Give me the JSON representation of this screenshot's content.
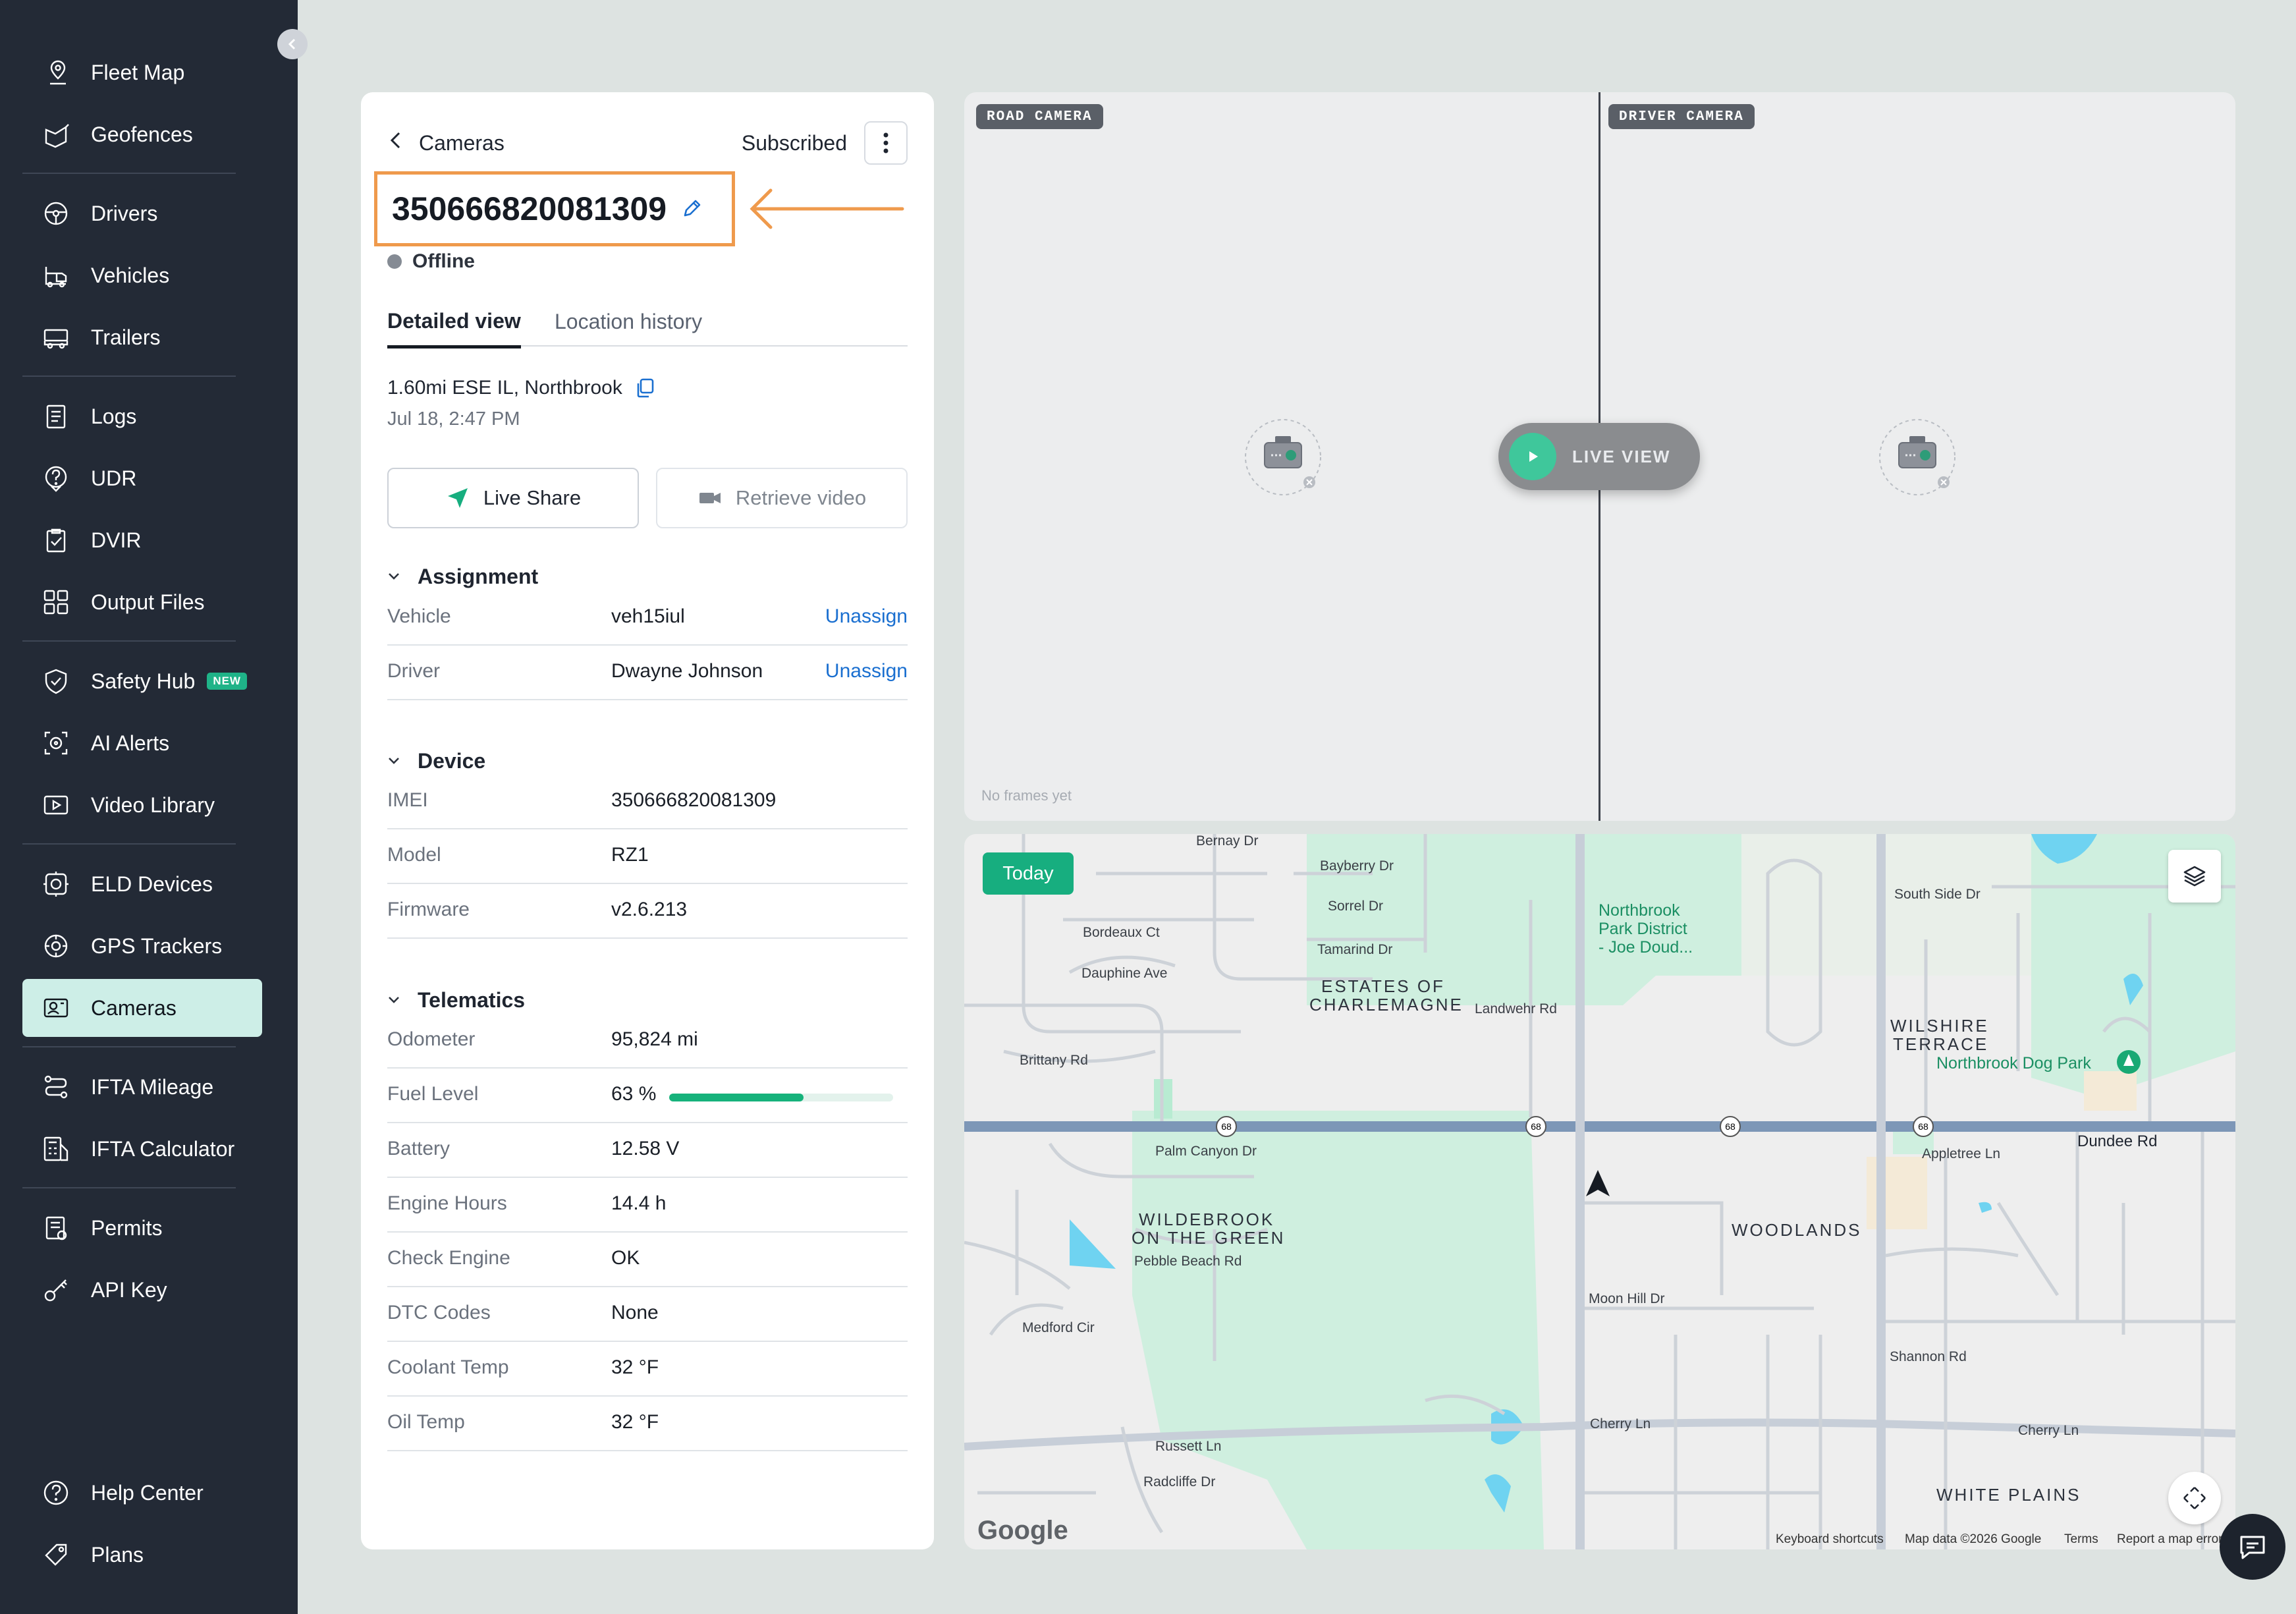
{
  "sidebar": {
    "items": [
      {
        "label": "Fleet Map",
        "icon": "fleet-map-icon"
      },
      {
        "label": "Geofences",
        "icon": "geofence-icon"
      },
      {
        "label": "Drivers",
        "icon": "steering-wheel-icon"
      },
      {
        "label": "Vehicles",
        "icon": "vehicle-icon"
      },
      {
        "label": "Trailers",
        "icon": "trailer-icon"
      },
      {
        "label": "Logs",
        "icon": "logs-icon"
      },
      {
        "label": "UDR",
        "icon": "question-icon"
      },
      {
        "label": "DVIR",
        "icon": "checklist-icon"
      },
      {
        "label": "Output Files",
        "icon": "files-icon"
      },
      {
        "label": "Safety Hub",
        "icon": "shield-icon",
        "badge": "NEW"
      },
      {
        "label": "AI Alerts",
        "icon": "ai-alert-icon"
      },
      {
        "label": "Video Library",
        "icon": "video-icon"
      },
      {
        "label": "ELD Devices",
        "icon": "eld-device-icon"
      },
      {
        "label": "GPS Trackers",
        "icon": "gps-tracker-icon"
      },
      {
        "label": "Cameras",
        "icon": "camera-icon",
        "active": true
      },
      {
        "label": "IFTA Mileage",
        "icon": "route-icon"
      },
      {
        "label": "IFTA Calculator",
        "icon": "calculator-icon"
      },
      {
        "label": "Permits",
        "icon": "permit-icon"
      },
      {
        "label": "API Key",
        "icon": "key-icon"
      },
      {
        "label": "Help Center",
        "icon": "help-icon"
      },
      {
        "label": "Plans",
        "icon": "tag-icon"
      }
    ]
  },
  "panel": {
    "back_title": "Cameras",
    "subscription": "Subscribed",
    "device_id": "350666820081309",
    "status": "Offline",
    "tabs": [
      "Detailed view",
      "Location history"
    ],
    "location": "1.60mi ESE IL, Northbrook",
    "timestamp": "Jul 18, 2:47 PM",
    "live_share": "Live Share",
    "retrieve_video": "Retrieve video",
    "assignment": {
      "title": "Assignment",
      "rows": [
        {
          "key": "Vehicle",
          "value": "veh15iul",
          "action": "Unassign"
        },
        {
          "key": "Driver",
          "value": "Dwayne Johnson",
          "action": "Unassign"
        }
      ]
    },
    "device": {
      "title": "Device",
      "rows": [
        {
          "key": "IMEI",
          "value": "350666820081309"
        },
        {
          "key": "Model",
          "value": "RZ1"
        },
        {
          "key": "Firmware",
          "value": "v2.6.213"
        }
      ]
    },
    "telematics": {
      "title": "Telematics",
      "fuel_level_fraction": 0.63,
      "rows": [
        {
          "key": "Odometer",
          "value": "95,824 mi"
        },
        {
          "key": "Fuel Level",
          "value": "63 %"
        },
        {
          "key": "Battery",
          "value": "12.58 V"
        },
        {
          "key": "Engine Hours",
          "value": "14.4 h"
        },
        {
          "key": "Check Engine",
          "value": "OK"
        },
        {
          "key": "DTC Codes",
          "value": "None"
        },
        {
          "key": "Coolant Temp",
          "value": "32 °F"
        },
        {
          "key": "Oil Temp",
          "value": "32 °F"
        }
      ]
    }
  },
  "cameras": {
    "road_label": "ROAD CAMERA",
    "driver_label": "DRIVER CAMERA",
    "live_view": "LIVE VIEW",
    "no_frames": "No frames yet"
  },
  "map": {
    "today": "Today",
    "streets": [
      "Bernay Dr",
      "Bayberry Dr",
      "Sorrel Dr",
      "Tamarind Dr",
      "Bordeaux Ct",
      "Dauphine Ave",
      "Brittany Rd",
      "Landwehr Rd",
      "Palm Canyon Dr",
      "Pebble Beach Rd",
      "Medford Cir",
      "Moon Hill Dr",
      "Cherry Ln",
      "Russett Ln",
      "Radcliffe Dr",
      "Shannon Rd",
      "Appletree Ln",
      "South Side Dr",
      "Dundee Rd"
    ],
    "areas": [
      "ESTATES OF CHARLEMAGNE",
      "WILDEBROOK ON THE GREEN",
      "WOODLANDS",
      "WILSHIRE TERRACE",
      "WHITE PLAINS"
    ],
    "poi": [
      "Northbrook Park District - Joe Doud...",
      "Northbrook Dog Park"
    ],
    "route_number": "68",
    "google": "Google",
    "attribution": [
      "Keyboard shortcuts",
      "Map data ©2026 Google",
      "Terms",
      "Report a map error"
    ]
  },
  "colors": {
    "sidebar": "#232a36",
    "accent": "#17ae7f",
    "active_nav": "#cdeee7",
    "highlight_box": "#ef9a4c",
    "link": "#1a6fd0"
  }
}
